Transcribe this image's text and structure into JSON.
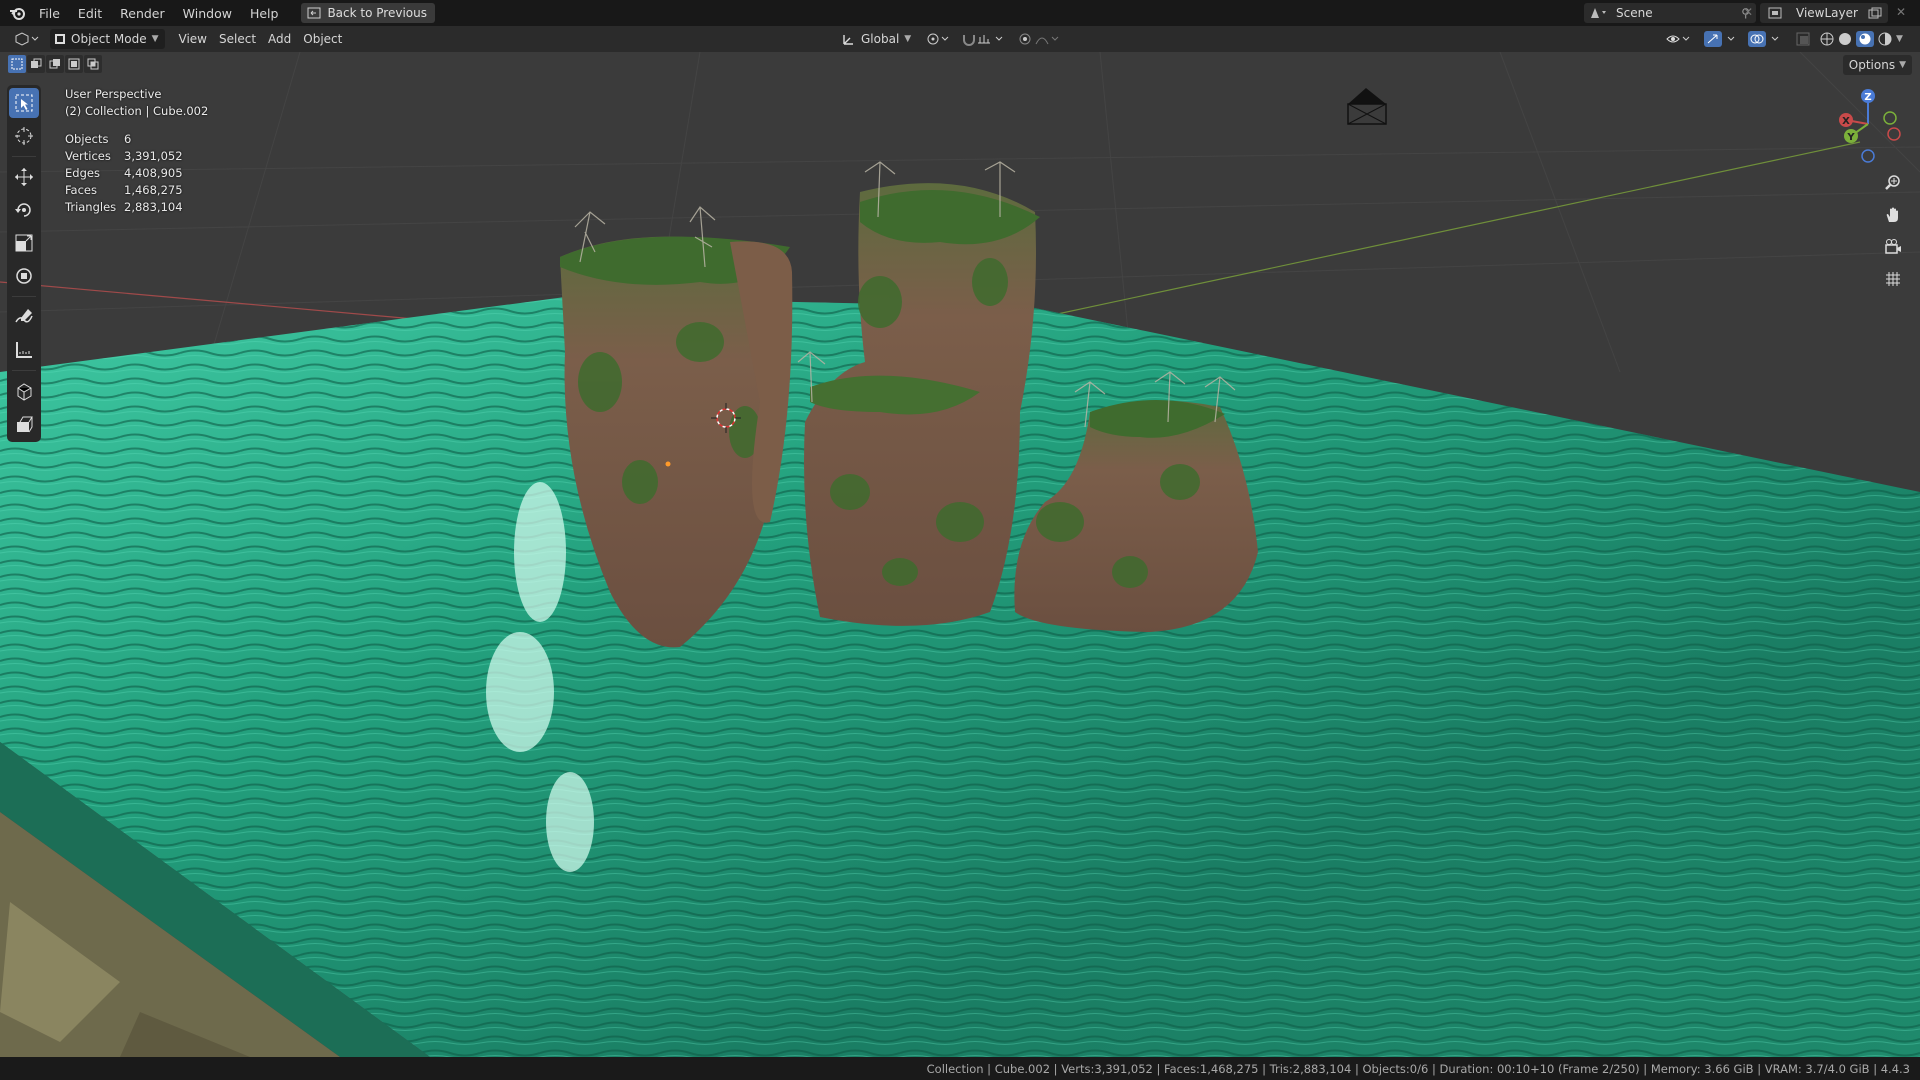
{
  "topbar": {
    "menus": [
      "File",
      "Edit",
      "Render",
      "Window",
      "Help"
    ],
    "back_label": "Back to Previous",
    "scene_label": "Scene",
    "viewlayer_label": "ViewLayer"
  },
  "header": {
    "mode_label": "Object Mode",
    "menus": [
      "View",
      "Select",
      "Add",
      "Object"
    ],
    "transform_orientation": "Global",
    "options_label": "Options"
  },
  "viewport": {
    "perspective_label": "User Perspective",
    "collection_label": "(2) Collection | Cube.002",
    "stats": [
      {
        "key": "Objects",
        "value": "6"
      },
      {
        "key": "Vertices",
        "value": "3,391,052"
      },
      {
        "key": "Edges",
        "value": "4,408,905"
      },
      {
        "key": "Faces",
        "value": "1,468,275"
      },
      {
        "key": "Triangles",
        "value": "2,883,104"
      }
    ],
    "gizmo": {
      "x": "X",
      "y": "Y",
      "z": "Z"
    }
  },
  "tools": [
    "select-box",
    "cursor",
    "move",
    "rotate",
    "scale",
    "transform",
    "annotate",
    "measure",
    "add-cube",
    "extrude"
  ],
  "statusbar": {
    "text": "Collection | Cube.002 | Verts:3,391,052 | Faces:1,468,275 | Tris:2,883,104 | Objects:0/6 | Duration: 00:10+10 (Frame 2/250) | Memory: 3.66 GiB | VRAM: 3.7/4.0 GiB | 4.4.3"
  },
  "colors": {
    "accent": "#4772b3",
    "water": "#1f8a6c",
    "grid_bg": "#3a3a3a",
    "axis_x": "#c94a4a",
    "axis_y": "#7bb03a",
    "axis_z": "#4a7bd6"
  }
}
